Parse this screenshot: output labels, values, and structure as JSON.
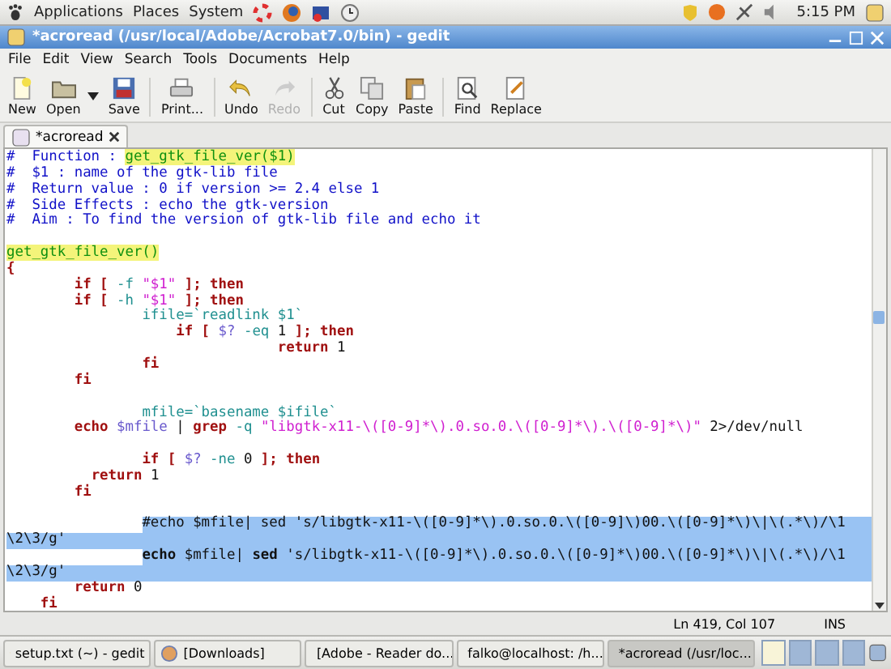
{
  "top_panel": {
    "menus": [
      "Applications",
      "Places",
      "System"
    ],
    "clock": "5:15 PM"
  },
  "window": {
    "title": "*acroread (/usr/local/Adobe/Acrobat7.0/bin) - gedit"
  },
  "menubar": [
    "File",
    "Edit",
    "View",
    "Search",
    "Tools",
    "Documents",
    "Help"
  ],
  "toolbar": [
    [
      {
        "label": "New",
        "kind": "new",
        "disabled": false,
        "dropdown": false
      },
      {
        "label": "Open",
        "kind": "open",
        "disabled": false,
        "dropdown": true
      },
      {
        "label": "Save",
        "kind": "save",
        "disabled": false,
        "dropdown": false
      }
    ],
    [
      {
        "label": "Print...",
        "kind": "print",
        "disabled": false,
        "dropdown": false
      }
    ],
    [
      {
        "label": "Undo",
        "kind": "undo",
        "disabled": false,
        "dropdown": false
      },
      {
        "label": "Redo",
        "kind": "redo",
        "disabled": true,
        "dropdown": false
      }
    ],
    [
      {
        "label": "Cut",
        "kind": "cut",
        "disabled": false,
        "dropdown": false
      },
      {
        "label": "Copy",
        "kind": "copy",
        "disabled": false,
        "dropdown": false
      },
      {
        "label": "Paste",
        "kind": "paste",
        "disabled": false,
        "dropdown": false
      }
    ],
    [
      {
        "label": "Find",
        "kind": "find",
        "disabled": false,
        "dropdown": false
      },
      {
        "label": "Replace",
        "kind": "replace",
        "disabled": false,
        "dropdown": false
      }
    ]
  ],
  "tabs": [
    {
      "label": "*acroread",
      "selected": true
    }
  ],
  "code": [
    {
      "selected": false,
      "tokens": [
        {
          "kind": "comment",
          "text": "#  Function : "
        },
        {
          "kind": "match",
          "text": "get_gtk_file_ver($1)"
        }
      ]
    },
    {
      "selected": false,
      "tokens": [
        {
          "kind": "comment",
          "text": "#  $1 : name of the gtk-lib file"
        }
      ]
    },
    {
      "selected": false,
      "tokens": [
        {
          "kind": "comment",
          "text": "#  Return value : 0 if version >= 2.4 else 1"
        }
      ]
    },
    {
      "selected": false,
      "tokens": [
        {
          "kind": "comment",
          "text": "#  Side Effects : echo the gtk-version"
        }
      ]
    },
    {
      "selected": false,
      "tokens": [
        {
          "kind": "comment",
          "text": "#  Aim : To find the version of gtk-lib file and echo it"
        }
      ]
    },
    {
      "selected": false
    },
    {
      "selected": false,
      "tokens": [
        {
          "kind": "match",
          "text": "get_gtk_file_ver()"
        }
      ]
    },
    {
      "selected": false,
      "tokens": [
        {
          "kind": "keyword",
          "text": "{"
        }
      ]
    },
    {
      "selected": false,
      "tokens": [
        {
          "kind": "keyword",
          "text": "        if [ "
        },
        {
          "kind": "option",
          "text": "-f "
        },
        {
          "kind": "string",
          "text": "\"$1\""
        },
        {
          "kind": "keyword",
          "text": " ]; then"
        }
      ]
    },
    {
      "selected": false,
      "tokens": [
        {
          "kind": "keyword",
          "text": "        if [ "
        },
        {
          "kind": "option",
          "text": "-h "
        },
        {
          "kind": "string",
          "text": "\"$1\""
        },
        {
          "kind": "keyword",
          "text": " ]; then"
        }
      ]
    },
    {
      "selected": false,
      "tokens": [
        {
          "kind": "command",
          "text": "                ifile=`readlink $1`"
        }
      ]
    },
    {
      "selected": false,
      "tokens": [
        {
          "kind": "keyword",
          "text": "                    if [ "
        },
        {
          "kind": "variable",
          "text": "$? "
        },
        {
          "kind": "option",
          "text": "-eq "
        },
        {
          "kind": "plain",
          "text": "1"
        },
        {
          "kind": "keyword",
          "text": " ]; then"
        }
      ]
    },
    {
      "selected": false,
      "tokens": [
        {
          "kind": "keyword",
          "text": "                                return "
        },
        {
          "kind": "plain",
          "text": "1"
        }
      ]
    },
    {
      "selected": false,
      "tokens": [
        {
          "kind": "keyword",
          "text": "                fi"
        }
      ]
    },
    {
      "selected": false,
      "tokens": [
        {
          "kind": "keyword",
          "text": "        fi"
        }
      ]
    },
    {
      "selected": false
    },
    {
      "selected": false,
      "tokens": [
        {
          "kind": "command",
          "text": "                mfile=`basename $ifile`"
        }
      ]
    },
    {
      "selected": false,
      "tokens": [
        {
          "kind": "keyword",
          "text": "        echo "
        },
        {
          "kind": "variable",
          "text": "$mfile"
        },
        {
          "kind": "plain",
          "text": " | "
        },
        {
          "kind": "keyword",
          "text": "grep "
        },
        {
          "kind": "option",
          "text": "-q "
        },
        {
          "kind": "string",
          "text": "\"libgtk-x11-\\([0-9]*\\).0.so.0.\\([0-9]*\\).\\([0-9]*\\)\""
        },
        {
          "kind": "plain",
          "text": " 2>/dev/null"
        }
      ]
    },
    {
      "selected": false
    },
    {
      "selected": false,
      "tokens": [
        {
          "kind": "keyword",
          "text": "                if [ "
        },
        {
          "kind": "variable",
          "text": "$? "
        },
        {
          "kind": "option",
          "text": "-ne "
        },
        {
          "kind": "plain",
          "text": "0"
        },
        {
          "kind": "keyword",
          "text": " ]; then"
        }
      ]
    },
    {
      "selected": false,
      "tokens": [
        {
          "kind": "keyword",
          "text": "          return "
        },
        {
          "kind": "plain",
          "text": "1"
        }
      ]
    },
    {
      "selected": false,
      "tokens": [
        {
          "kind": "keyword",
          "text": "        fi"
        }
      ]
    },
    {
      "selected": false
    },
    {
      "selected": true,
      "tokens": [
        {
          "kind": "plain",
          "text": "                #echo $mfile| sed 's/libgtk-x11-\\([0-9]*\\).0.so.0.\\([0-9]\\)00.\\([0-9]*\\)\\|\\(.*\\)/\\1"
        }
      ]
    },
    {
      "selected": true,
      "tokens": [
        {
          "kind": "plain",
          "text": "\\2\\3/g'"
        }
      ]
    },
    {
      "selected": true,
      "tokens": [
        {
          "kind": "bold",
          "text": "                echo "
        },
        {
          "kind": "plain",
          "text": "$mfile| "
        },
        {
          "kind": "bold",
          "text": "sed "
        },
        {
          "kind": "plain",
          "text": "'s/libgtk-x11-\\([0-9]*\\).0.so.0.\\([0-9]*\\)00.\\([0-9]*\\)\\|\\(.*\\)/\\1"
        }
      ]
    },
    {
      "selected": true,
      "tokens": [
        {
          "kind": "plain",
          "text": "\\2\\3/g'"
        }
      ]
    },
    {
      "selected": false,
      "tokens": [
        {
          "kind": "keyword",
          "text": "        return "
        },
        {
          "kind": "plain",
          "text": "0"
        }
      ]
    },
    {
      "selected": false,
      "tokens": [
        {
          "kind": "keyword",
          "text": "    fi"
        }
      ]
    }
  ],
  "status_bar": {
    "position": "Ln 419, Col 107",
    "mode": "INS"
  },
  "taskbar": [
    {
      "label": "setup.txt (~) - gedit",
      "kind": "note",
      "selected": false
    },
    {
      "label": "[Downloads]",
      "kind": "globe",
      "selected": false
    },
    {
      "label": "[Adobe - Reader do...",
      "kind": "globe",
      "selected": false
    },
    {
      "label": "falko@localhost: /h...",
      "kind": "terminal",
      "selected": false
    },
    {
      "label": "*acroread (/usr/loc...",
      "kind": "note",
      "selected": true
    }
  ],
  "workspaces": [
    {
      "selected": true
    },
    {
      "selected": false
    },
    {
      "selected": false
    },
    {
      "selected": false
    }
  ]
}
